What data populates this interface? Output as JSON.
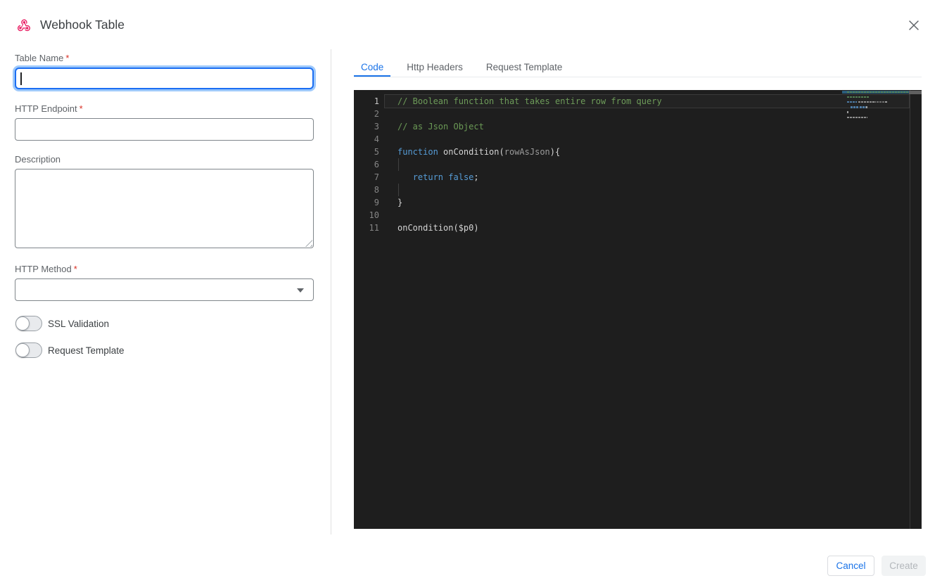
{
  "header": {
    "title": "Webhook Table",
    "icon": "webhook",
    "icon_color": "#e91e63"
  },
  "form": {
    "required_mark": "*",
    "table_name": {
      "label": "Table Name",
      "required": true,
      "value": "",
      "focused": true
    },
    "http_endpoint": {
      "label": "HTTP Endpoint",
      "required": true,
      "value": ""
    },
    "description": {
      "label": "Description",
      "required": false,
      "value": ""
    },
    "http_method": {
      "label": "HTTP Method",
      "required": true,
      "value": ""
    },
    "ssl_validation": {
      "label": "SSL Validation",
      "state": "off"
    },
    "request_template": {
      "label": "Request Template",
      "state": "off"
    }
  },
  "tabs": {
    "items": [
      {
        "label": "Code",
        "active": true
      },
      {
        "label": "Http Headers",
        "active": false
      },
      {
        "label": "Request Template",
        "active": false
      }
    ]
  },
  "editor": {
    "language": "javascript",
    "current_line": 1,
    "lines": [
      {
        "num": 1,
        "tokens": [
          [
            "comment",
            "// Boolean function that takes entire row from query"
          ]
        ]
      },
      {
        "num": 2,
        "tokens": []
      },
      {
        "num": 3,
        "tokens": [
          [
            "comment",
            "// as Json Object"
          ]
        ]
      },
      {
        "num": 4,
        "tokens": []
      },
      {
        "num": 5,
        "tokens": [
          [
            "keyword",
            "function"
          ],
          [
            "plain",
            " "
          ],
          [
            "ident",
            "onCondition"
          ],
          [
            "plain",
            "("
          ],
          [
            "param",
            "rowAsJson"
          ],
          [
            "plain",
            "){"
          ]
        ]
      },
      {
        "num": 6,
        "tokens": [],
        "indent_guide": true
      },
      {
        "num": 7,
        "tokens": [
          [
            "plain",
            "   "
          ],
          [
            "keyword",
            "return"
          ],
          [
            "plain",
            " "
          ],
          [
            "keyword",
            "false"
          ],
          [
            "plain",
            ";"
          ]
        ]
      },
      {
        "num": 8,
        "tokens": [],
        "indent_guide": true
      },
      {
        "num": 9,
        "tokens": [
          [
            "plain",
            "}"
          ]
        ]
      },
      {
        "num": 10,
        "tokens": []
      },
      {
        "num": 11,
        "tokens": [
          [
            "ident",
            "onCondition($p0)"
          ]
        ]
      }
    ],
    "colors": {
      "background": "#1e1e1e",
      "comment": "#6a9955",
      "keyword": "#569cd6",
      "identifier": "#d4d4d4",
      "parameter": "#9b9b9b",
      "line_number": "#858585",
      "line_number_active": "#c6c6c6"
    }
  },
  "footer": {
    "cancel_label": "Cancel",
    "create_label": "Create"
  },
  "colors": {
    "accent": "#1a73e8",
    "required": "#d93025",
    "divider": "#e0e0e0"
  }
}
